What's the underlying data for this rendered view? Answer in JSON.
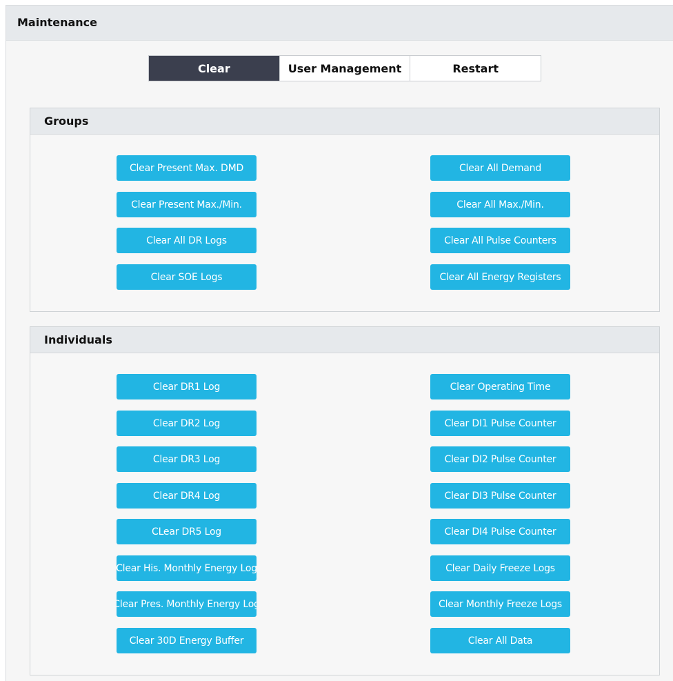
{
  "page": {
    "title": "Maintenance"
  },
  "tabs": [
    {
      "label": "Clear",
      "active": true
    },
    {
      "label": "User Management",
      "active": false
    },
    {
      "label": "Restart",
      "active": false
    }
  ],
  "groups": {
    "title": "Groups",
    "left": [
      "Clear Present Max. DMD",
      "Clear Present Max./Min.",
      "Clear All DR Logs",
      "Clear SOE Logs"
    ],
    "right": [
      "Clear All Demand",
      "Clear All Max./Min.",
      "Clear All Pulse Counters",
      "Clear All Energy Registers"
    ]
  },
  "individuals": {
    "title": "Individuals",
    "left": [
      "Clear DR1 Log",
      "Clear DR2 Log",
      "Clear DR3 Log",
      "Clear DR4 Log",
      "CLear DR5 Log",
      "Clear His. Monthly Energy Log",
      "Clear Pres. Monthly Energy Log",
      "Clear 30D Energy Buffer"
    ],
    "right": [
      "Clear Operating Time",
      "Clear DI1 Pulse Counter",
      "Clear DI2 Pulse Counter",
      "Clear DI3 Pulse Counter",
      "Clear DI4 Pulse Counter",
      "Clear Daily Freeze Logs",
      "Clear Monthly Freeze Logs",
      "Clear All Data"
    ]
  },
  "colors": {
    "button": "#22b5e3",
    "active_tab": "#3b3f4e",
    "header_bg": "#e6e9ec"
  }
}
